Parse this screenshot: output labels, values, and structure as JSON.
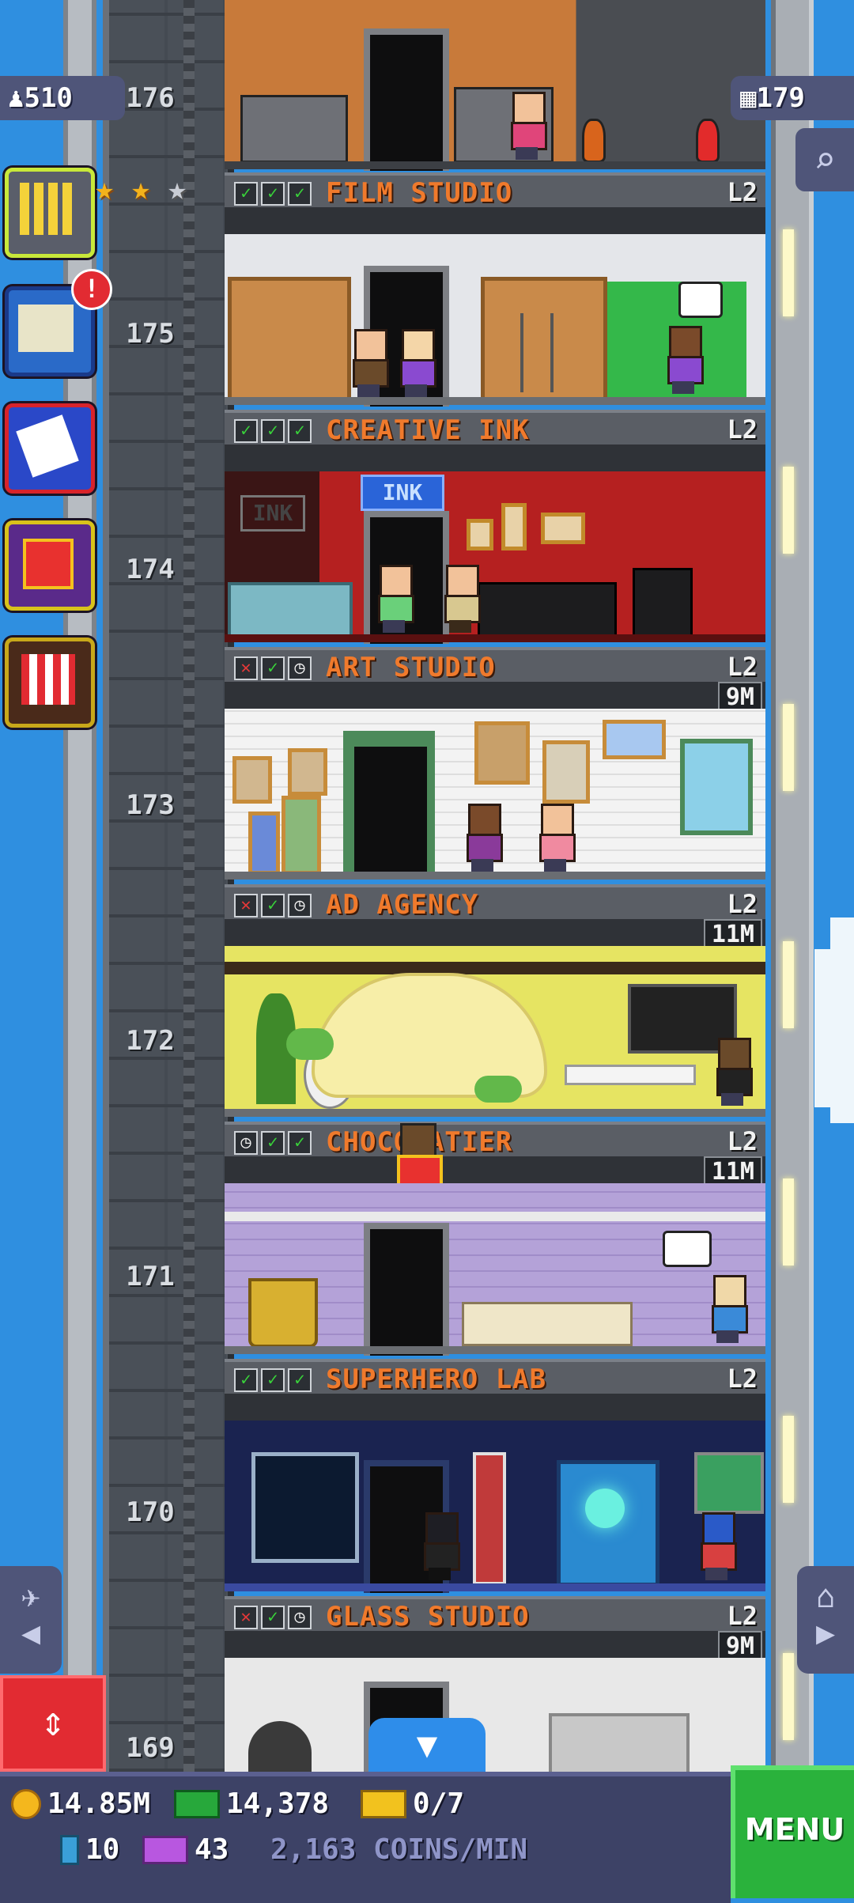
{
  "hud": {
    "population": "510",
    "floors": "179",
    "stars_filled": 2,
    "stars_total": 3
  },
  "shaft_floor_numbers": [
    "176",
    "175",
    "174",
    "173",
    "172",
    "171",
    "170",
    "169"
  ],
  "floors": [
    {
      "name": "FILM STUDIO",
      "level": "L2",
      "stock": [
        "check",
        "check",
        "check"
      ],
      "timer": ""
    },
    {
      "name": "CREATIVE INK",
      "level": "L2",
      "stock": [
        "check",
        "check",
        "check"
      ],
      "timer": ""
    },
    {
      "name": "ART STUDIO",
      "level": "L2",
      "stock": [
        "x",
        "check",
        "clock"
      ],
      "timer": "9M"
    },
    {
      "name": "AD AGENCY",
      "level": "L2",
      "stock": [
        "x",
        "check",
        "clock"
      ],
      "timer": "11M"
    },
    {
      "name": "CHOCOLATIER",
      "level": "L2",
      "stock": [
        "clock",
        "check",
        "check"
      ],
      "timer": "11M"
    },
    {
      "name": "SUPERHERO LAB",
      "level": "L2",
      "stock": [
        "check",
        "check",
        "check"
      ],
      "timer": ""
    },
    {
      "name": "GLASS STUDIO",
      "level": "L2",
      "stock": [
        "x",
        "check",
        "clock"
      ],
      "timer": "9M"
    }
  ],
  "room_signs": {
    "ink_sign": "INK",
    "ink_wall": "INK"
  },
  "bottom_bar": {
    "coins": "14.85M",
    "bux": "14,378",
    "tickets": "0/7",
    "bitizen_bux": "10",
    "vip": "43",
    "rate": "2,163 COINS/MIN",
    "menu": "MENU"
  },
  "colors": {
    "sky": "#2f8fe0",
    "banner_text": "#f07a2c",
    "menu_green": "#2ab23c",
    "elevator_red": "#e22b32"
  }
}
